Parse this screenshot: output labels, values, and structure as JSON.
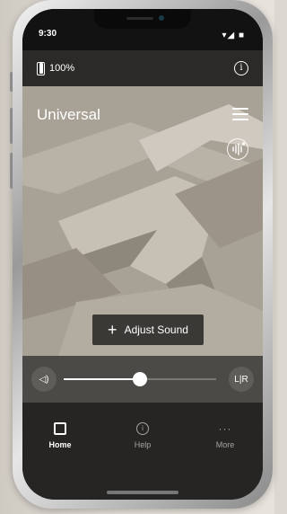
{
  "status": {
    "time": "9:30",
    "signal": "▾◢ ■"
  },
  "device": {
    "battery_label": "100%",
    "battery_level": 1.0,
    "info_symbol": "i"
  },
  "hero": {
    "program_name": "Universal",
    "adjust_label": "Adjust Sound",
    "adjust_symbol": "+"
  },
  "volume": {
    "speaker_symbol": "◁)",
    "balance_label": "L|R",
    "level": 0.5
  },
  "tabs": [
    {
      "label": "Home",
      "icon": "home-icon",
      "active": true
    },
    {
      "label": "Help",
      "icon": "info-icon",
      "active": false
    },
    {
      "label": "More",
      "icon": "more-icon",
      "active": false
    }
  ],
  "more_symbol": "···",
  "help_symbol": "i",
  "colors": {
    "background": "#dcd8d1",
    "screen": "#2b2a28",
    "accent": "#ffffff"
  }
}
